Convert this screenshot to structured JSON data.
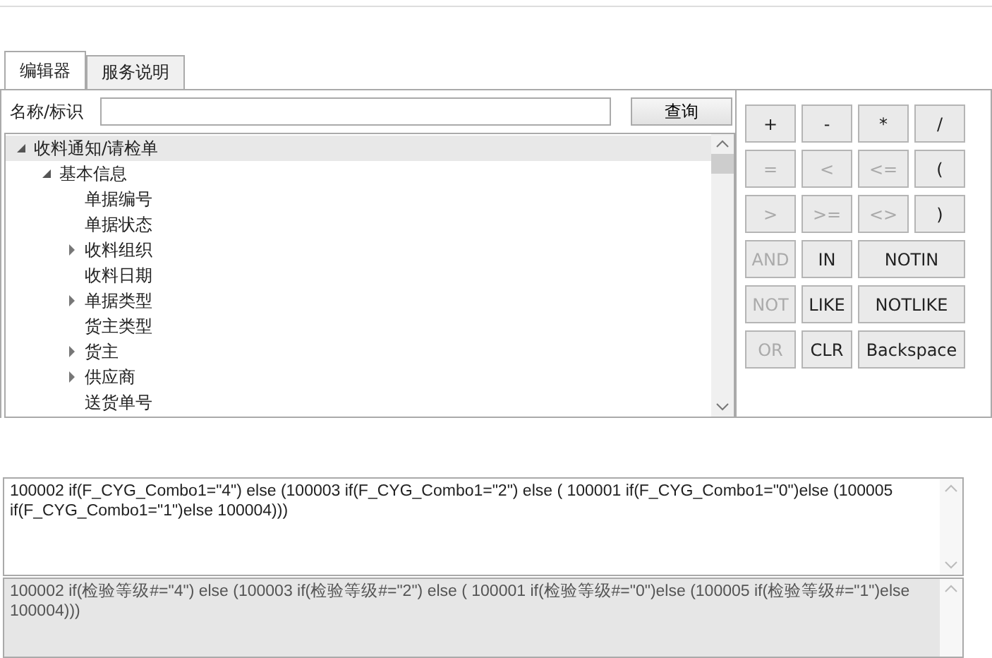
{
  "tabs": [
    {
      "label": "编辑器",
      "selected": true
    },
    {
      "label": "服务说明",
      "selected": false
    }
  ],
  "search": {
    "label": "名称/标识",
    "button": "查询"
  },
  "tree": [
    {
      "label": "收料通知/请检单",
      "selected": true,
      "expanded": true,
      "children": [
        {
          "label": "基本信息",
          "selected": false,
          "expanded": true,
          "children": [
            {
              "label": "单据编号",
              "selected": false
            },
            {
              "label": "单据状态",
              "selected": false
            },
            {
              "label": "收料组织",
              "selected": false,
              "expanded": false
            },
            {
              "label": "收料日期",
              "selected": false
            },
            {
              "label": "单据类型",
              "selected": false,
              "expanded": false
            },
            {
              "label": "货主类型",
              "selected": false
            },
            {
              "label": "货主",
              "selected": false,
              "expanded": false
            },
            {
              "label": "供应商",
              "selected": false,
              "expanded": false
            },
            {
              "label": "送货单号",
              "selected": false
            }
          ]
        }
      ]
    }
  ],
  "operators": [
    {
      "label": "+",
      "disabled": false,
      "wide": false
    },
    {
      "label": "-",
      "disabled": false,
      "wide": false
    },
    {
      "label": "*",
      "disabled": false,
      "wide": false
    },
    {
      "label": "/",
      "disabled": false,
      "wide": false
    },
    {
      "label": "=",
      "disabled": true,
      "wide": false
    },
    {
      "label": "<",
      "disabled": true,
      "wide": false
    },
    {
      "label": "<=",
      "disabled": true,
      "wide": false
    },
    {
      "label": "(",
      "disabled": false,
      "wide": false
    },
    {
      "label": ">",
      "disabled": true,
      "wide": false
    },
    {
      "label": ">=",
      "disabled": true,
      "wide": false
    },
    {
      "label": "<>",
      "disabled": true,
      "wide": false
    },
    {
      "label": ")",
      "disabled": false,
      "wide": false
    },
    {
      "label": "AND",
      "disabled": true,
      "wide": false
    },
    {
      "label": "IN",
      "disabled": false,
      "wide": false
    },
    {
      "label": "NOTIN",
      "disabled": false,
      "wide": true
    },
    {
      "label": "NOT",
      "disabled": true,
      "wide": false
    },
    {
      "label": "LIKE",
      "disabled": false,
      "wide": false
    },
    {
      "label": "NOTLIKE",
      "disabled": false,
      "wide": true
    },
    {
      "label": "OR",
      "disabled": true,
      "wide": false
    },
    {
      "label": "CLR",
      "disabled": false,
      "wide": false
    },
    {
      "label": "Backspace",
      "disabled": false,
      "wide": true
    }
  ],
  "expression": {
    "value": "100002 if(F_CYG_Combo1=\"4\") else (100003 if(F_CYG_Combo1=\"2\") else ( 100001 if(F_CYG_Combo1=\"0\")else (100005 if(F_CYG_Combo1=\"1\")else 100004)))"
  },
  "description": {
    "value": "100002 if(检验等级#=\"4\") else (100003 if(检验等级#=\"2\") else ( 100001 if(检验等级#=\"0\")else  (100005 if(检验等级#=\"1\")else 100004)))"
  }
}
